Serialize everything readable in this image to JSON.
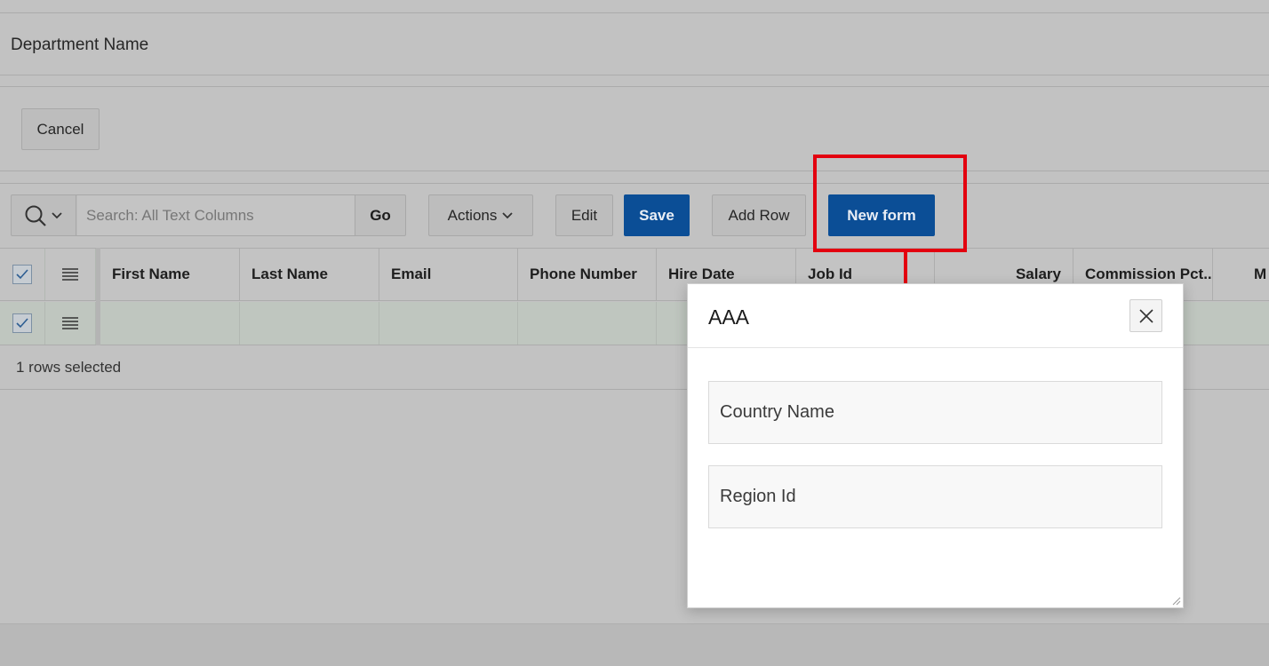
{
  "page": {
    "field_label": "Department Name",
    "cancel_label": "Cancel"
  },
  "toolbar": {
    "search_placeholder": "Search: All Text Columns",
    "go_label": "Go",
    "actions_label": "Actions",
    "edit_label": "Edit",
    "save_label": "Save",
    "add_row_label": "Add Row",
    "new_form_label": "New form"
  },
  "grid": {
    "columns": [
      "First Name",
      "Last Name",
      "Email",
      "Phone Number",
      "Hire Date",
      "Job Id",
      "Salary",
      "Commission Pct...",
      "M"
    ],
    "status": "1 rows selected"
  },
  "dialog": {
    "title": "AAA",
    "fields": [
      "Country Name",
      "Region Id"
    ]
  },
  "colors": {
    "primary": "#0b4e96",
    "annotation": "#e3000f"
  },
  "icons": [
    "search-icon",
    "chevron-down-icon",
    "checkbox-icon",
    "row-menu-icon",
    "close-icon",
    "resize-grip-icon"
  ]
}
